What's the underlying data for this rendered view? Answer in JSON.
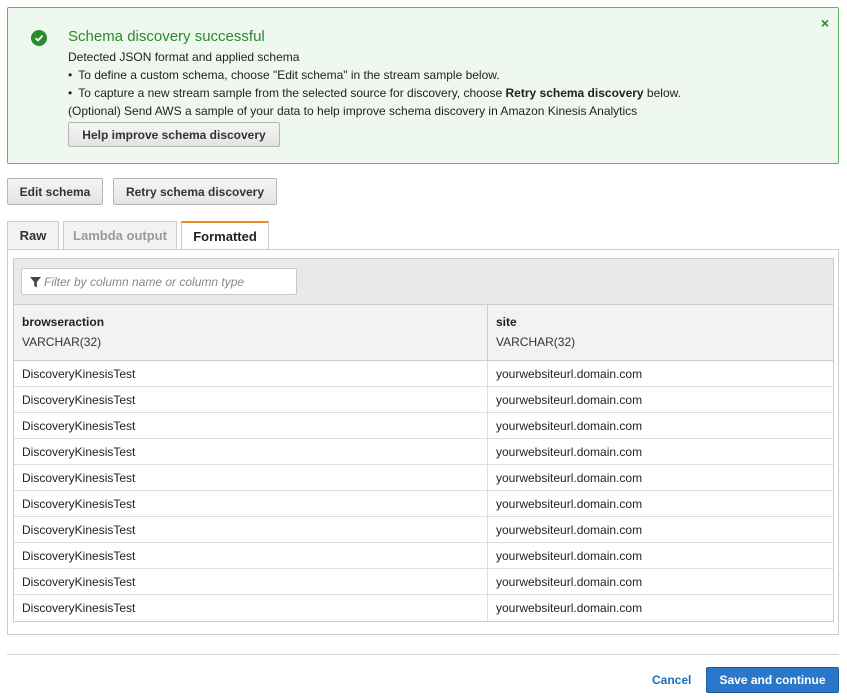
{
  "alert": {
    "title": "Schema discovery successful",
    "line1": "Detected JSON format and applied schema",
    "line2": "To define a custom schema, choose \"Edit schema\" in the stream sample below.",
    "line3_pre": "To capture a new stream sample from the selected source for discovery, choose ",
    "line3_bold": "Retry schema discovery",
    "line3_post": " below.",
    "line4": "(Optional) Send AWS a sample of your data to help improve schema discovery in Amazon Kinesis Analytics",
    "help_button": "Help improve schema discovery",
    "close_glyph": "×",
    "status_color": "#2b8a2b"
  },
  "toolbar": {
    "edit_schema": "Edit schema",
    "retry_schema_discovery": "Retry schema discovery"
  },
  "tabs": [
    {
      "label": "Raw",
      "state": "inactive"
    },
    {
      "label": "Lambda output",
      "state": "disabled"
    },
    {
      "label": "Formatted",
      "state": "active"
    }
  ],
  "filter": {
    "placeholder": "Filter by column name or column type"
  },
  "table": {
    "columns": [
      {
        "name": "browseraction",
        "type": "VARCHAR(32)"
      },
      {
        "name": "site",
        "type": "VARCHAR(32)"
      }
    ],
    "rows": [
      [
        "DiscoveryKinesisTest",
        "yourwebsiteurl.domain.com"
      ],
      [
        "DiscoveryKinesisTest",
        "yourwebsiteurl.domain.com"
      ],
      [
        "DiscoveryKinesisTest",
        "yourwebsiteurl.domain.com"
      ],
      [
        "DiscoveryKinesisTest",
        "yourwebsiteurl.domain.com"
      ],
      [
        "DiscoveryKinesisTest",
        "yourwebsiteurl.domain.com"
      ],
      [
        "DiscoveryKinesisTest",
        "yourwebsiteurl.domain.com"
      ],
      [
        "DiscoveryKinesisTest",
        "yourwebsiteurl.domain.com"
      ],
      [
        "DiscoveryKinesisTest",
        "yourwebsiteurl.domain.com"
      ],
      [
        "DiscoveryKinesisTest",
        "yourwebsiteurl.domain.com"
      ],
      [
        "DiscoveryKinesisTest",
        "yourwebsiteurl.domain.com"
      ]
    ]
  },
  "footer": {
    "cancel": "Cancel",
    "save_and_continue": "Save and continue",
    "accent_color": "#2a78c9"
  }
}
